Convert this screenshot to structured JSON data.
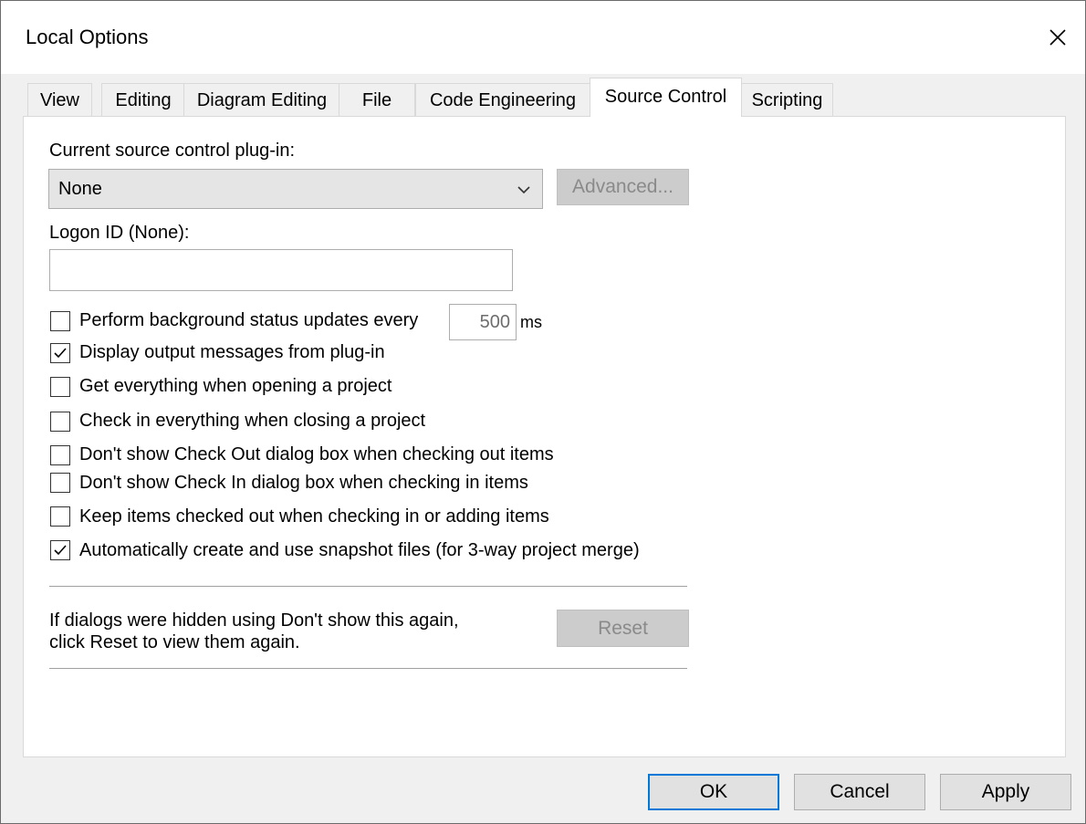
{
  "window": {
    "title": "Local Options"
  },
  "tabs": [
    {
      "label": "View"
    },
    {
      "label": "Editing"
    },
    {
      "label": "Diagram Editing"
    },
    {
      "label": "File"
    },
    {
      "label": "Code Engineering"
    },
    {
      "label": "Source Control",
      "active": true
    },
    {
      "label": "Scripting"
    }
  ],
  "source_control": {
    "plugin_label": "Current source control plug-in:",
    "plugin_value": "None",
    "advanced_button": "Advanced...",
    "logon_label": "Logon ID (None):",
    "logon_value": "",
    "background_updates_label": "Perform background status updates every",
    "background_updates_value": "500",
    "background_updates_unit": "ms",
    "options": [
      {
        "label": "Display output messages from plug-in",
        "checked": true
      },
      {
        "label": "Get everything when opening a project",
        "checked": false
      },
      {
        "label": "Check in everything when closing a project",
        "checked": false
      },
      {
        "label": "Don't show Check Out dialog box when checking out items",
        "checked": false
      },
      {
        "label": "Don't show Check In dialog box when checking in items",
        "checked": false
      },
      {
        "label": "Keep items checked out when checking in or adding items",
        "checked": false
      },
      {
        "label": "Automatically create and use snapshot files (for 3-way project merge)",
        "checked": true
      }
    ],
    "background_updates_checked": false,
    "reset_text_line1": "If dialogs were hidden using Don't show this again,",
    "reset_text_line2": "click Reset to view them again.",
    "reset_button": "Reset"
  },
  "footer": {
    "ok_label": "OK",
    "cancel_label": "Cancel",
    "apply_label": "Apply"
  },
  "colors": {
    "focus_border": "#0078d7",
    "disabled_text": "#8a8a8a"
  }
}
